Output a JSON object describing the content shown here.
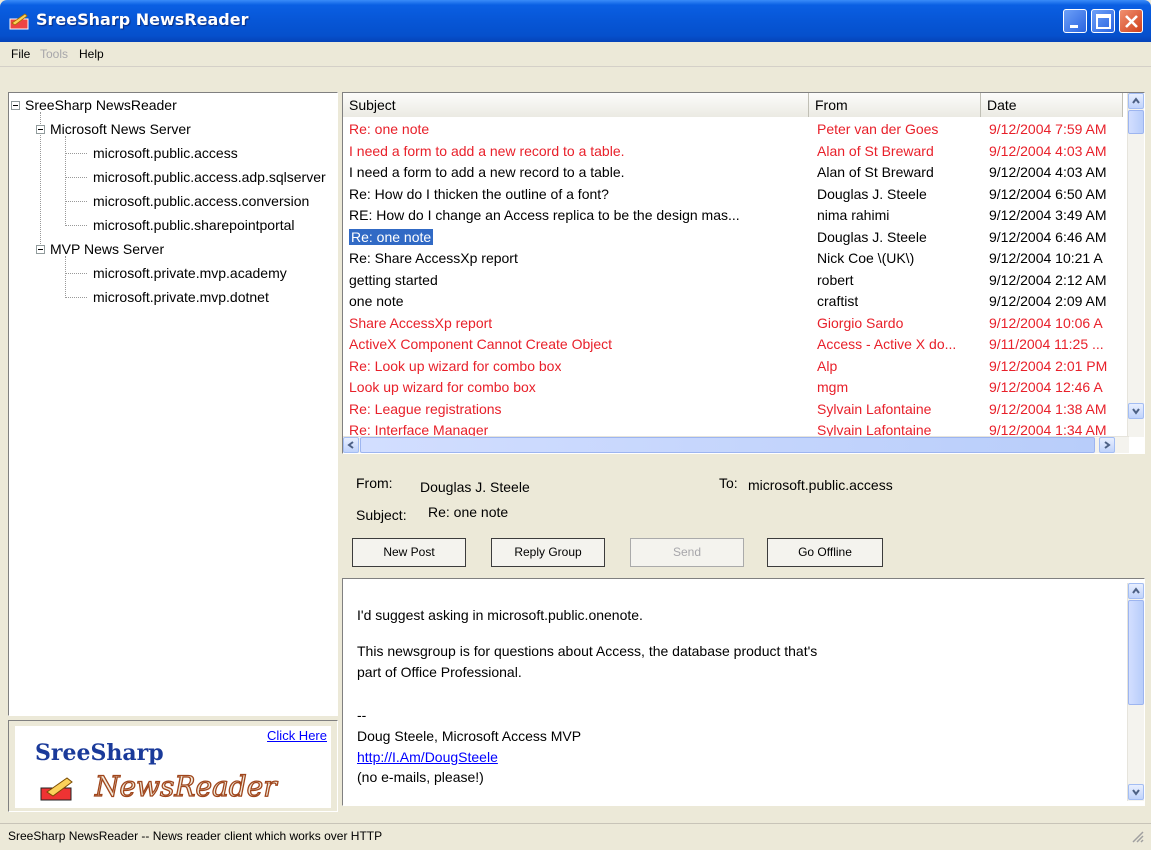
{
  "window": {
    "title": "SreeSharp NewsReader"
  },
  "menu": {
    "file": "File",
    "tools": "Tools",
    "help": "Help"
  },
  "tree": {
    "root": "SreeSharp NewsReader",
    "servers": [
      {
        "name": "Microsoft News Server",
        "groups": [
          "microsoft.public.access",
          "microsoft.public.access.adp.sqlserver",
          "microsoft.public.access.conversion",
          "microsoft.public.sharepointportal"
        ]
      },
      {
        "name": "MVP News Server",
        "groups": [
          "microsoft.private.mvp.academy",
          "microsoft.private.mvp.dotnet"
        ]
      }
    ]
  },
  "logo": {
    "click_here": "Click Here",
    "line1": "SreeSharp",
    "line2": "NewsReader"
  },
  "messages": {
    "columns": [
      "Subject",
      "From",
      "Date"
    ],
    "rows": [
      {
        "subject": "Re: one note",
        "from": "Peter van der Goes",
        "date": "9/12/2004 7:59 AM",
        "unread": true
      },
      {
        "subject": "I need a form to add  a new record to a table.",
        "from": "Alan of St Breward",
        "date": "9/12/2004 4:03 AM",
        "unread": true
      },
      {
        "subject": "I need a form to add  a new record to a table.",
        "from": "Alan of St Breward",
        "date": "9/12/2004 4:03 AM",
        "unread": false
      },
      {
        "subject": "Re: How do I thicken the outline of a font?",
        "from": "Douglas J. Steele",
        "date": "9/12/2004 6:50 AM",
        "unread": false
      },
      {
        "subject": "RE: How do I change an Access replica to be the design mas...",
        "from": "nima rahimi",
        "date": "9/12/2004 3:49 AM",
        "unread": false
      },
      {
        "subject": "Re: one note",
        "from": "Douglas J. Steele",
        "date": "9/12/2004 6:46 AM",
        "unread": false,
        "selected": true
      },
      {
        "subject": "Re: Share AccessXp report",
        "from": "Nick Coe \\(UK\\)",
        "date": "9/12/2004 10:21 A",
        "unread": false
      },
      {
        "subject": "getting started",
        "from": "robert",
        "date": "9/12/2004 2:12 AM",
        "unread": false
      },
      {
        "subject": "one note",
        "from": "craftist",
        "date": "9/12/2004 2:09 AM",
        "unread": false
      },
      {
        "subject": "Share AccessXp report",
        "from": "Giorgio Sardo",
        "date": "9/12/2004 10:06 A",
        "unread": true
      },
      {
        "subject": "ActiveX Component Cannot Create Object",
        "from": "Access - Active X do...",
        "date": "9/11/2004 11:25 ...",
        "unread": true
      },
      {
        "subject": "Re: Look up wizard for combo box",
        "from": "Alp",
        "date": "9/12/2004 2:01 PM",
        "unread": true
      },
      {
        "subject": "Look up wizard for combo box",
        "from": "mgm",
        "date": "9/12/2004 12:46 A",
        "unread": true
      },
      {
        "subject": "Re: League registrations",
        "from": "Sylvain Lafontaine",
        "date": "9/12/2004 1:38 AM",
        "unread": true
      },
      {
        "subject": "Re: Interface Manager",
        "from": "Sylvain Lafontaine",
        "date": "9/12/2004 1:34 AM",
        "unread": true
      }
    ]
  },
  "detail": {
    "from_label": "From:",
    "from_value": "Douglas J. Steele",
    "to_label": "To:",
    "to_value": "microsoft.public.access",
    "subject_label": "Subject:",
    "subject_value": "Re: one note"
  },
  "buttons": {
    "new_post": "New Post",
    "reply_group": "Reply Group",
    "send": "Send",
    "go_offline": "Go Offline"
  },
  "body": {
    "lines": [
      "I'd suggest asking in microsoft.public.onenote.",
      "This newsgroup is for questions about Access, the database product that's",
      "part of Office Professional.",
      "--",
      "Doug Steele, Microsoft Access MVP"
    ],
    "link": "http://I.Am/DougSteele",
    "footer": "(no e-mails, please!)"
  },
  "status": {
    "text": "SreeSharp NewsReader --  News reader client which works over HTTP"
  }
}
